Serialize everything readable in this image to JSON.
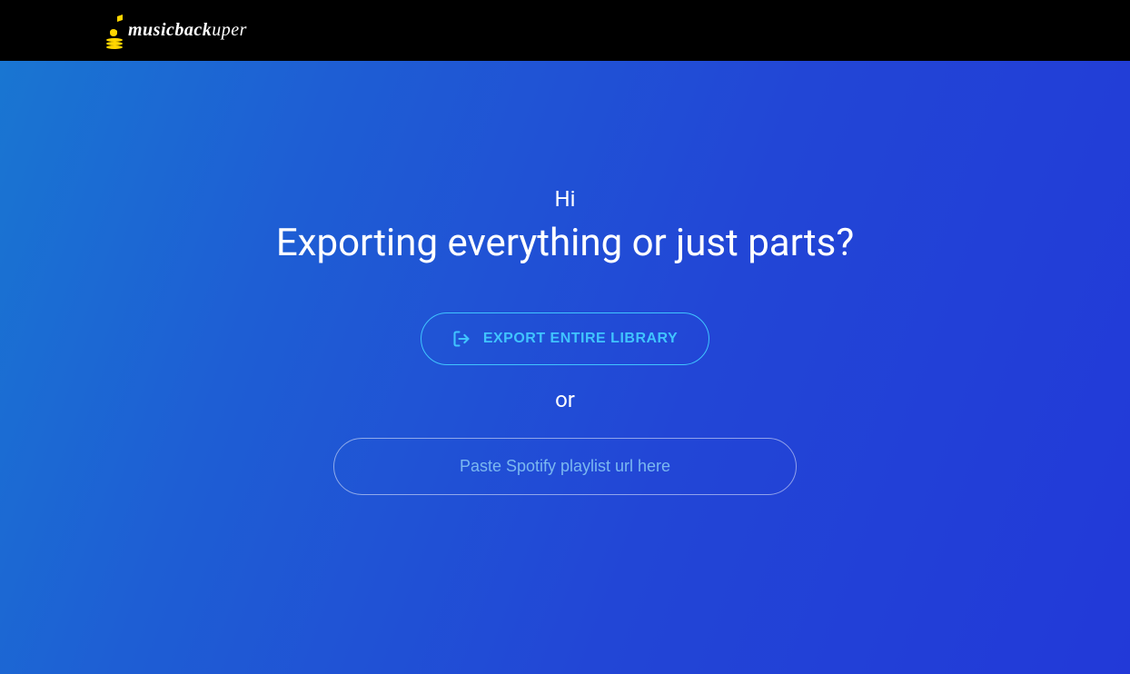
{
  "header": {
    "logo": {
      "text_bold": "musicback",
      "text_light": "uper"
    }
  },
  "main": {
    "greeting": "Hi",
    "title": "Exporting everything or just parts?",
    "export_button_label": "EXPORT ENTIRE LIBRARY",
    "or_text": "or",
    "url_input_placeholder": "Paste Spotify playlist url here"
  },
  "colors": {
    "accent_cyan": "#40c4ff",
    "logo_yellow": "#ffd600"
  }
}
